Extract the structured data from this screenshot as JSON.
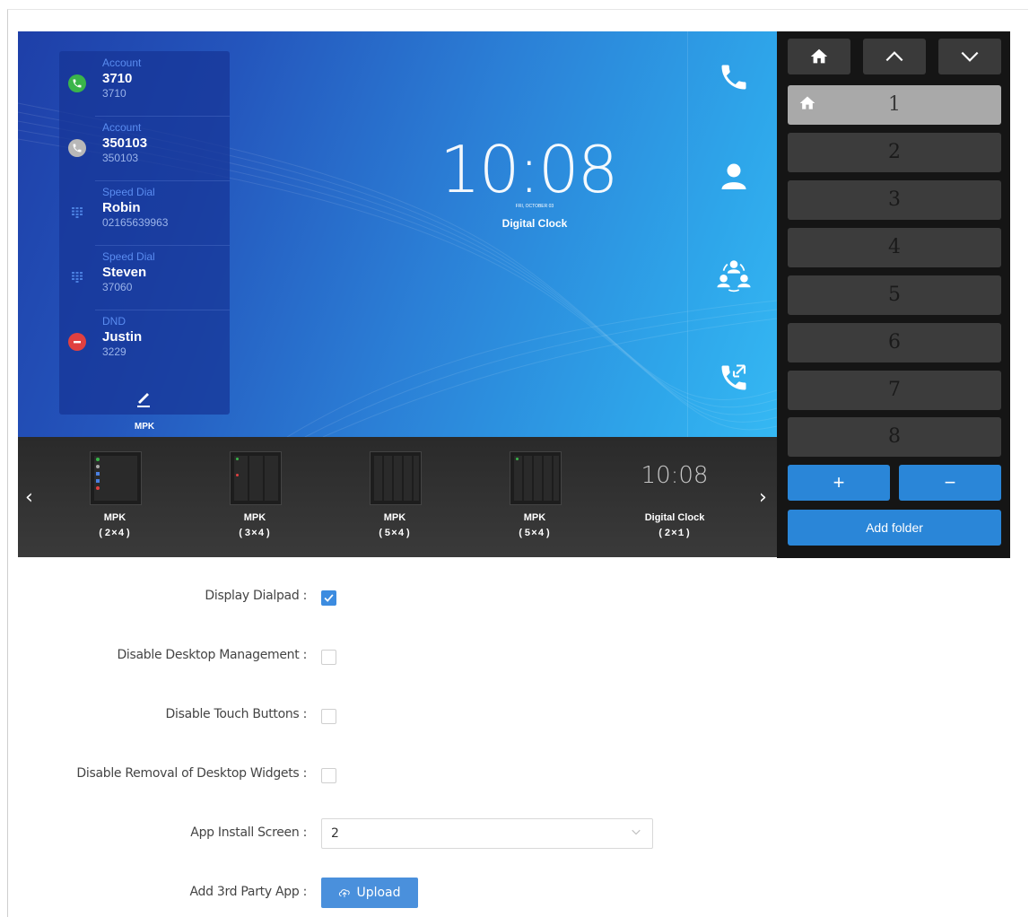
{
  "mpk_panel": {
    "entries": [
      {
        "type": "Account",
        "name": "3710",
        "number": "3710",
        "icon": "phone-green-icon",
        "color": "#3ab54a"
      },
      {
        "type": "Account",
        "name": "350103",
        "number": "350103",
        "icon": "phone-gray-icon",
        "color": "#b8b8b8"
      },
      {
        "type": "Speed Dial",
        "name": "Robin",
        "number": "02165639963",
        "icon": "dialpad-icon",
        "color": "#4a7fe0"
      },
      {
        "type": "Speed Dial",
        "name": "Steven",
        "number": "37060",
        "icon": "dialpad-icon",
        "color": "#4a7fe0"
      },
      {
        "type": "DND",
        "name": "Justin",
        "number": "3229",
        "icon": "dnd-icon",
        "color": "#e04040"
      }
    ],
    "caption": "MPK"
  },
  "clock": {
    "time": "10:08",
    "date": "FRI, OCTOBER 03",
    "label": "Digital Clock"
  },
  "right_strip_icons": [
    "phone-icon",
    "contact-icon",
    "conference-icon",
    "call-transfer-icon"
  ],
  "thumbnails": [
    {
      "title": "MPK",
      "size": "(2×4)"
    },
    {
      "title": "MPK",
      "size": "(3×4)"
    },
    {
      "title": "MPK",
      "size": "(5×4)"
    },
    {
      "title": "MPK",
      "size": "(5×4)"
    },
    {
      "title": "Digital Clock",
      "size": "(2×1)",
      "preview_time": "10:08"
    }
  ],
  "pages": {
    "items": [
      "1",
      "2",
      "3",
      "4",
      "5",
      "6",
      "7",
      "8"
    ],
    "active": "1",
    "add_folder_label": "Add folder",
    "plus_label": "+",
    "minus_label": "−"
  },
  "form": {
    "display_dialpad": {
      "label": "Display Dialpad :",
      "checked": true
    },
    "disable_desktop_management": {
      "label": "Disable Desktop Management :",
      "checked": false
    },
    "disable_touch_buttons": {
      "label": "Disable Touch Buttons :",
      "checked": false
    },
    "disable_removal_widgets": {
      "label": "Disable Removal of Desktop Widgets :",
      "checked": false
    },
    "app_install_screen": {
      "label": "App Install Screen :",
      "value": "2"
    },
    "add_3rd_party_app": {
      "label": "Add 3rd Party App :",
      "button": "Upload"
    }
  },
  "colors": {
    "accent": "#2a86d8",
    "checkbox_checked": "#3c8ce0"
  }
}
